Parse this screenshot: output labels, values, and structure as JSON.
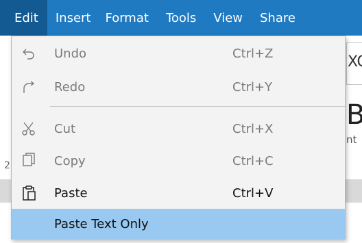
{
  "menubar": {
    "items": [
      "Edit",
      "Insert",
      "Format",
      "Tools",
      "View",
      "Share"
    ],
    "active": "Edit"
  },
  "edit_menu": {
    "undo": {
      "label": "Undo",
      "shortcut": "Ctrl+Z",
      "enabled": false,
      "icon": "undo-icon"
    },
    "redo": {
      "label": "Redo",
      "shortcut": "Ctrl+Y",
      "enabled": false,
      "icon": "redo-icon"
    },
    "cut": {
      "label": "Cut",
      "shortcut": "Ctrl+X",
      "enabled": false,
      "icon": "scissors-icon"
    },
    "copy": {
      "label": "Copy",
      "shortcut": "Ctrl+C",
      "enabled": false,
      "icon": "copy-icon"
    },
    "paste": {
      "label": "Paste",
      "shortcut": "Ctrl+V",
      "enabled": true,
      "icon": "clipboard-icon"
    },
    "paste_text_only": {
      "label": "Paste Text Only",
      "highlighted": true
    }
  },
  "background": {
    "field_text": "XC",
    "heading_letter": "B",
    "small_text": "nt",
    "side_number": "2"
  },
  "colors": {
    "menubar": "#1f7ac1",
    "menubar_active": "#145a92",
    "menu_bg": "#f3f3f3",
    "highlight": "#99c9f0"
  }
}
